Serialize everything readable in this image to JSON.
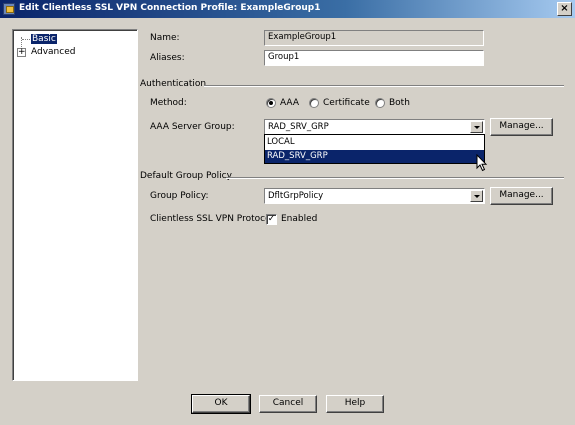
{
  "window": {
    "title": "Edit Clientless SSL VPN Connection Profile: ExampleGroup1",
    "close_glyph": "×"
  },
  "tree": {
    "items": [
      {
        "label": "Basic",
        "selected": true
      },
      {
        "label": "Advanced",
        "expander": "+"
      }
    ]
  },
  "form": {
    "name_label": "Name:",
    "name_value": "ExampleGroup1",
    "aliases_label": "Aliases:",
    "aliases_value": "Group1",
    "auth_title": "Authentication",
    "method_label": "Method:",
    "method_options": [
      {
        "label": "AAA",
        "selected": true
      },
      {
        "label": "Certificate",
        "selected": false
      },
      {
        "label": "Both",
        "selected": false
      }
    ],
    "aaa_label": "AAA Server Group:",
    "aaa_value": "RAD_SRV_GRP",
    "aaa_manage": "Manage...",
    "aaa_options": [
      {
        "label": "LOCAL",
        "selected": false
      },
      {
        "label": "RAD_SRV_GRP",
        "selected": true
      }
    ],
    "dgp_title": "Default Group Policy",
    "gp_label": "Group Policy:",
    "gp_value": "DfltGrpPolicy",
    "gp_manage": "Manage...",
    "protocol_label": "Clientless SSL VPN Protocol:",
    "protocol_check": "✓",
    "protocol_enabled_label": "Enabled"
  },
  "footer": {
    "ok": "OK",
    "cancel": "Cancel",
    "help": "Help"
  },
  "colors": {
    "selection": "#0a246a",
    "face": "#d4d0c8"
  }
}
